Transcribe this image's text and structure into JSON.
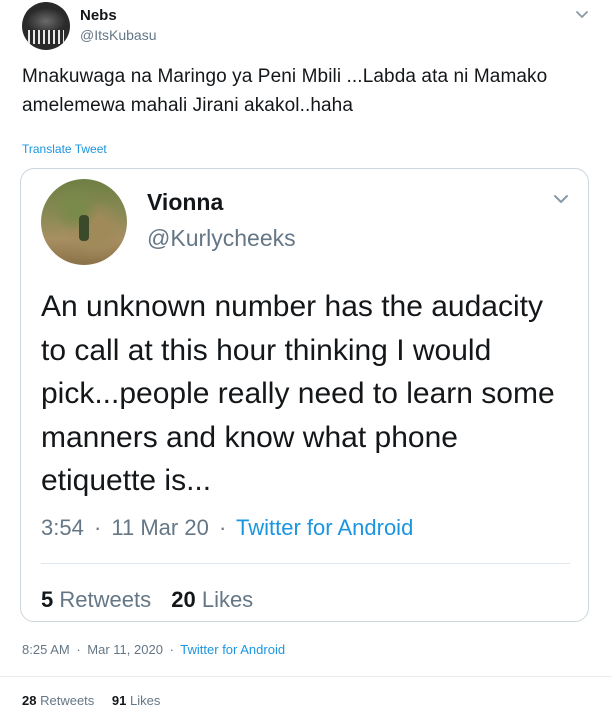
{
  "tweet": {
    "author_name": "Nebs",
    "author_handle": "@ItsKubasu",
    "text": "Mnakuwaga na Maringo ya Peni Mbili ...Labda ata ni Mamako amelemewa mahali Jirani akakol..haha",
    "translate_label": "Translate Tweet",
    "time": "8:25 AM",
    "date": "Mar 11, 2020",
    "separator": "·",
    "source": "Twitter for Android",
    "retweets_count": "28",
    "retweets_label": "Retweets",
    "likes_count": "91",
    "likes_label": "Likes"
  },
  "quoted": {
    "author_name": "Vionna",
    "author_handle": "@Kurlycheeks",
    "text": "An unknown number has the au­dacity to call at this hour thinking I would pick...people really need to learn some manners and know what phone etiquette is...",
    "time": "3:54",
    "date": "11 Mar 20",
    "separator": "·",
    "source": "Twitter for Android",
    "retweets_count": "5",
    "retweets_label": "Retweets",
    "likes_count": "20",
    "likes_label": "Likes"
  },
  "icons": {
    "caret": "chevron-down-icon"
  },
  "colors": {
    "link": "#1b95e0",
    "secondary_text": "#657786",
    "primary_text": "#14171a",
    "border": "#ccd6dd"
  }
}
